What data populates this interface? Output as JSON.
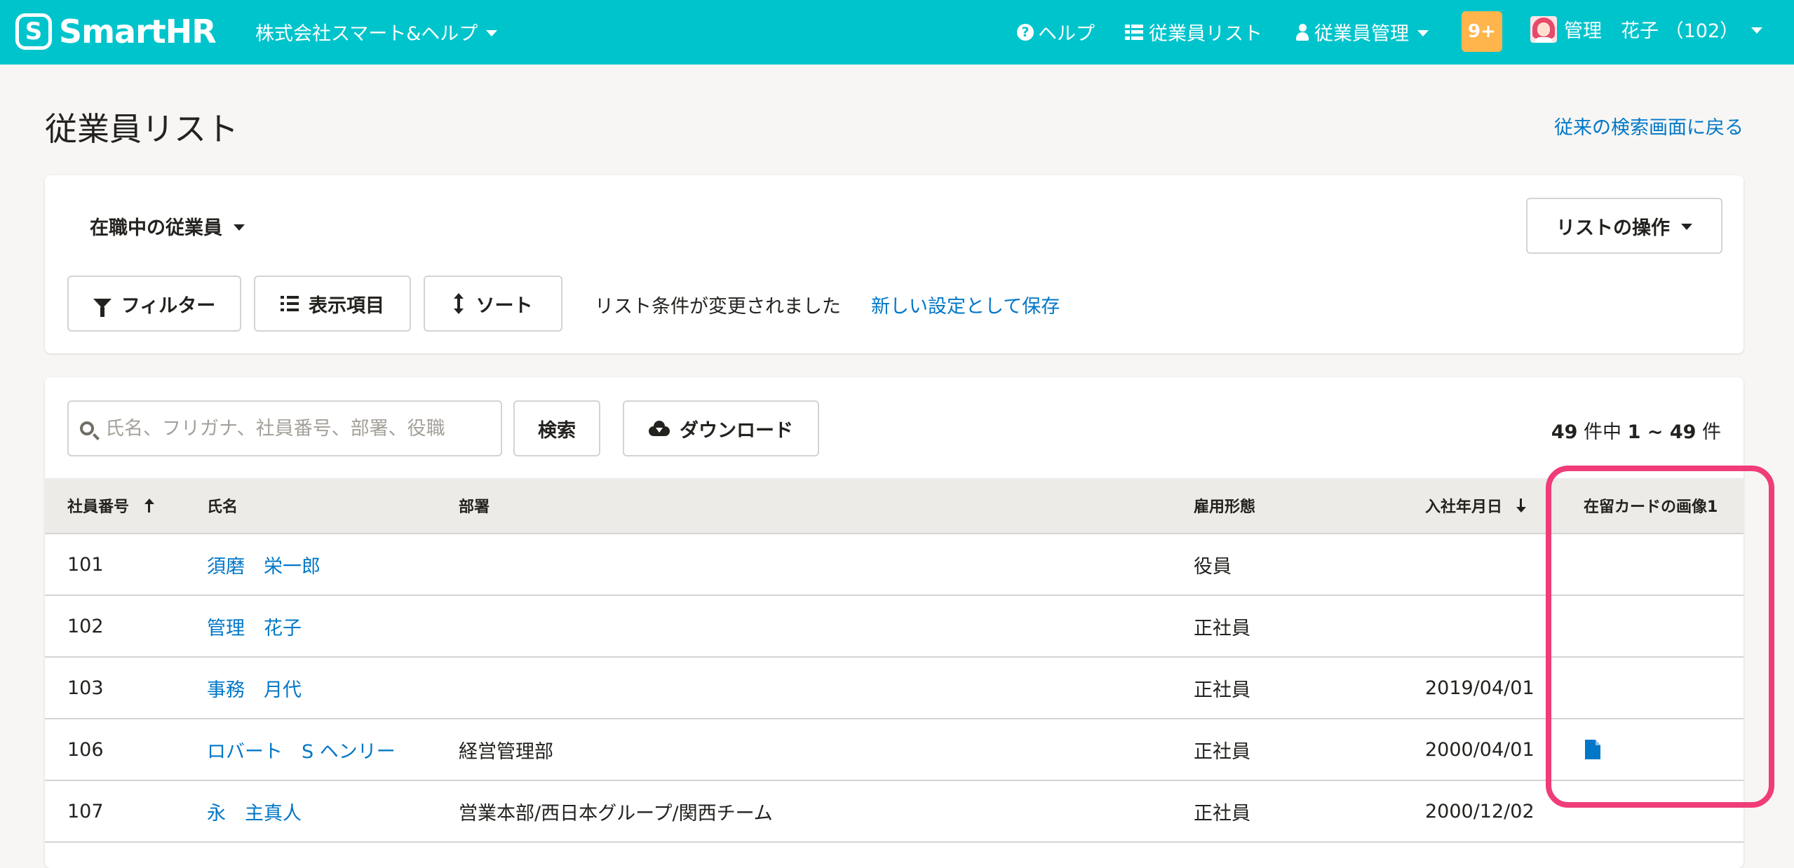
{
  "header": {
    "logo_mark": "S",
    "logo_text": "SmartHR",
    "company": "株式会社スマート&ヘルプ",
    "help": "ヘルプ",
    "employee_list": "従業員リスト",
    "employee_management": "従業員管理",
    "notifications": "9+",
    "user": "管理　花子 （102）"
  },
  "page": {
    "title": "従業員リスト",
    "back_link": "従来の検索画面に戻る"
  },
  "list_panel": {
    "list_select": "在職中の従業員",
    "list_ops": "リストの操作",
    "filter": "フィルター",
    "columns": "表示項目",
    "sort": "ソート",
    "status": "リスト条件が変更されました",
    "save_link": "新しい設定として保存"
  },
  "search": {
    "placeholder": "氏名、フリガナ、社員番号、部署、役職",
    "button": "検索",
    "download": "ダウンロード",
    "count_total": "49",
    "count_mid": " 件中 ",
    "count_range": "1 ~ 49",
    "count_suffix": " 件"
  },
  "table": {
    "headers": {
      "id": "社員番号",
      "name": "氏名",
      "dept": "部署",
      "employment": "雇用形態",
      "hire_date": "入社年月日",
      "card_image": "在留カードの画像1"
    },
    "rows": [
      {
        "id": "101",
        "name": "須磨　栄一郎",
        "dept": "",
        "employment": "役員",
        "hire_date": "",
        "has_card": false
      },
      {
        "id": "102",
        "name": "管理　花子",
        "dept": "",
        "employment": "正社員",
        "hire_date": "",
        "has_card": false
      },
      {
        "id": "103",
        "name": "事務　月代",
        "dept": "",
        "employment": "正社員",
        "hire_date": "2019/04/01",
        "has_card": false
      },
      {
        "id": "106",
        "name": "ロバート　S ヘンリー",
        "dept": "経営管理部",
        "employment": "正社員",
        "hire_date": "2000/04/01",
        "has_card": true
      },
      {
        "id": "107",
        "name": "永　主真人",
        "dept": "営業本部/西日本グループ/関西チーム",
        "employment": "正社員",
        "hire_date": "2000/12/02",
        "has_card": false
      }
    ]
  },
  "colors": {
    "header_bg": "#00c4cc",
    "link": "#0077c7",
    "badge": "#ffb54c",
    "highlight": "#f03c78"
  },
  "icons": [
    "help-icon",
    "list-icon",
    "user-icon",
    "caret-down-icon",
    "filter-icon",
    "columns-icon",
    "sort-icon",
    "search-icon",
    "cloud-download-icon",
    "arrow-up-icon",
    "arrow-down-icon",
    "document-icon"
  ]
}
